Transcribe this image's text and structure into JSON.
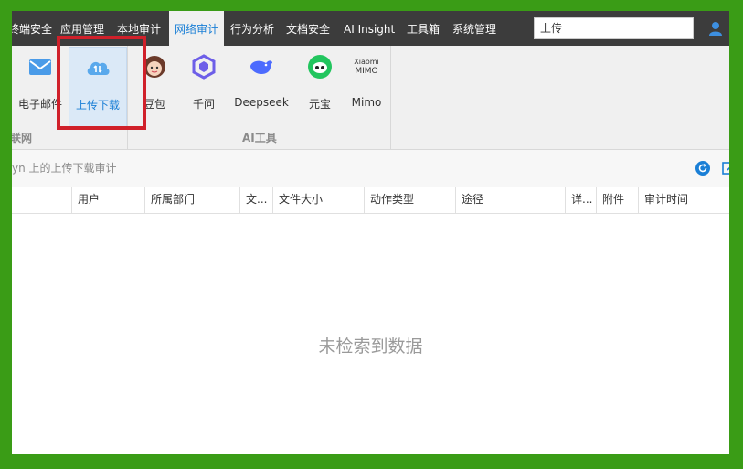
{
  "menubar": {
    "items": [
      "终端安全",
      "应用管理",
      "本地审计",
      "网络审计",
      "行为分析",
      "文档安全",
      "AI Insight",
      "工具箱",
      "系统管理"
    ],
    "active_index": 3,
    "search_value": "上传"
  },
  "ribbon": {
    "tools": [
      {
        "label": "电子邮件",
        "icon": "mail-icon"
      },
      {
        "label": "上传下载",
        "icon": "cloud-upload-download-icon"
      },
      {
        "label": "豆包",
        "icon": "doubao-icon"
      },
      {
        "label": "千问",
        "icon": "qianwen-icon"
      },
      {
        "label": "Deepseek",
        "icon": "deepseek-icon"
      },
      {
        "label": "元宝",
        "icon": "yuanbao-icon"
      },
      {
        "label": "Mimo",
        "icon": "mimo-icon",
        "logo_text": "Xiaomi MIMO"
      }
    ],
    "groups": [
      "联网",
      "AI工具"
    ]
  },
  "subbar": {
    "text": "yn 上的上传下载审计"
  },
  "table": {
    "columns": [
      "用户",
      "所属部门",
      "文...",
      "文件大小",
      "动作类型",
      "途径",
      "详...",
      "附件",
      "审计时间"
    ]
  },
  "empty_message": "未检索到数据",
  "colors": {
    "accent": "#1a7fd6",
    "highlight": "#d0202a",
    "frame": "#3a9c16",
    "menubar_bg": "#3c3c3c"
  }
}
